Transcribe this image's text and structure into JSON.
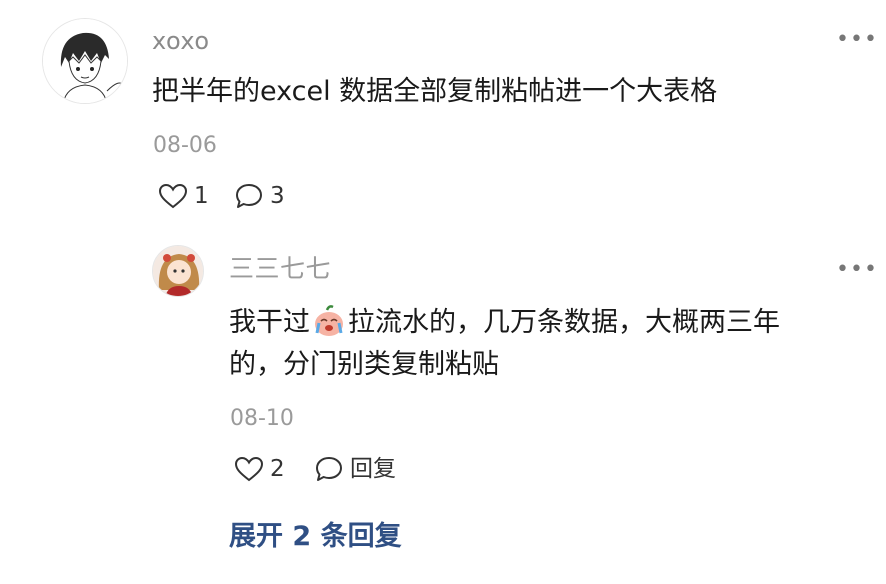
{
  "comment": {
    "username": "xoxo",
    "more_icon": "more-dots-icon",
    "content": "把半年的excel 数据全部复制粘帖进一个大表格",
    "date": "08-06",
    "like_count": "1",
    "reply_count": "3"
  },
  "reply": {
    "username": "三三七七",
    "content_part1": "我干过",
    "content_part2": "拉流水的，几万条数据，大概两三年",
    "content_line2": "的，分门别类复制粘贴",
    "date": "08-10",
    "like_count": "2",
    "reply_label": "回复"
  },
  "expand_label": "展开 2 条回复",
  "colors": {
    "username": "#8a8a8a",
    "date": "#9a9a9a",
    "expand_link": "#2f4f84",
    "text": "#1a1a1a"
  }
}
